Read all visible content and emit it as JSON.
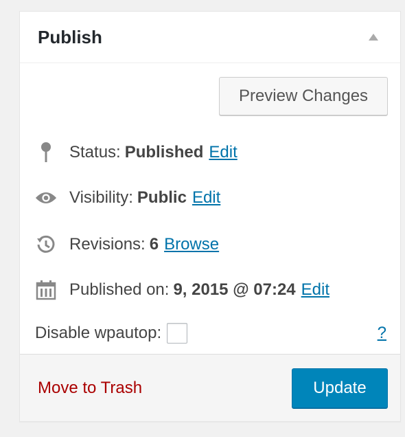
{
  "header": {
    "title": "Publish",
    "toggle_icon": "triangle-up-icon"
  },
  "actions": {
    "preview_label": "Preview Changes"
  },
  "status": {
    "label": "Status:",
    "value": "Published",
    "edit": "Edit",
    "icon": "pin-icon"
  },
  "visibility": {
    "label": "Visibility:",
    "value": "Public",
    "edit": "Edit",
    "icon": "eye-icon"
  },
  "revisions": {
    "label": "Revisions:",
    "value": "6",
    "link": "Browse",
    "icon": "history-icon"
  },
  "published": {
    "label": "Published on:",
    "value": "9, 2015 @ 07:24",
    "edit": "Edit",
    "icon": "calendar-icon"
  },
  "wpautop": {
    "label": "Disable wpautop:",
    "help": "?"
  },
  "footer": {
    "trash_label": "Move to Trash",
    "update_label": "Update"
  },
  "colors": {
    "link": "#0073aa",
    "trash": "#a00000",
    "primary": "#0085ba"
  }
}
